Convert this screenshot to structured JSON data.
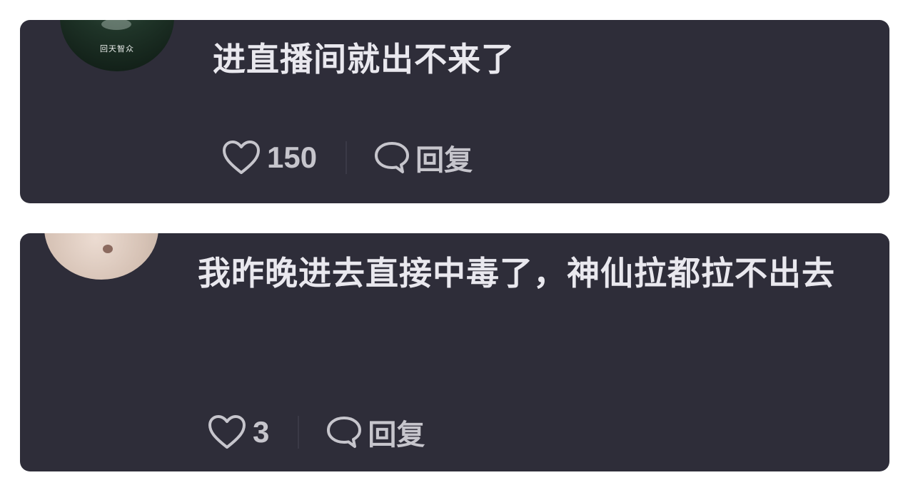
{
  "comments": [
    {
      "avatar_text": "回天智众",
      "text": "进直播间就出不来了",
      "like_count": "150",
      "reply_label": "回复"
    },
    {
      "text": "我昨晚进去直接中毒了，神仙拉都拉不出去",
      "like_count": "3",
      "reply_label": "回复"
    }
  ],
  "colors": {
    "card_background": "#2e2d39",
    "page_background": "#ffffff",
    "text_primary": "#e9e8ee",
    "text_secondary": "#c6c5cc"
  },
  "icons": {
    "like": "heart-outline-icon",
    "reply": "speech-bubble-icon"
  }
}
